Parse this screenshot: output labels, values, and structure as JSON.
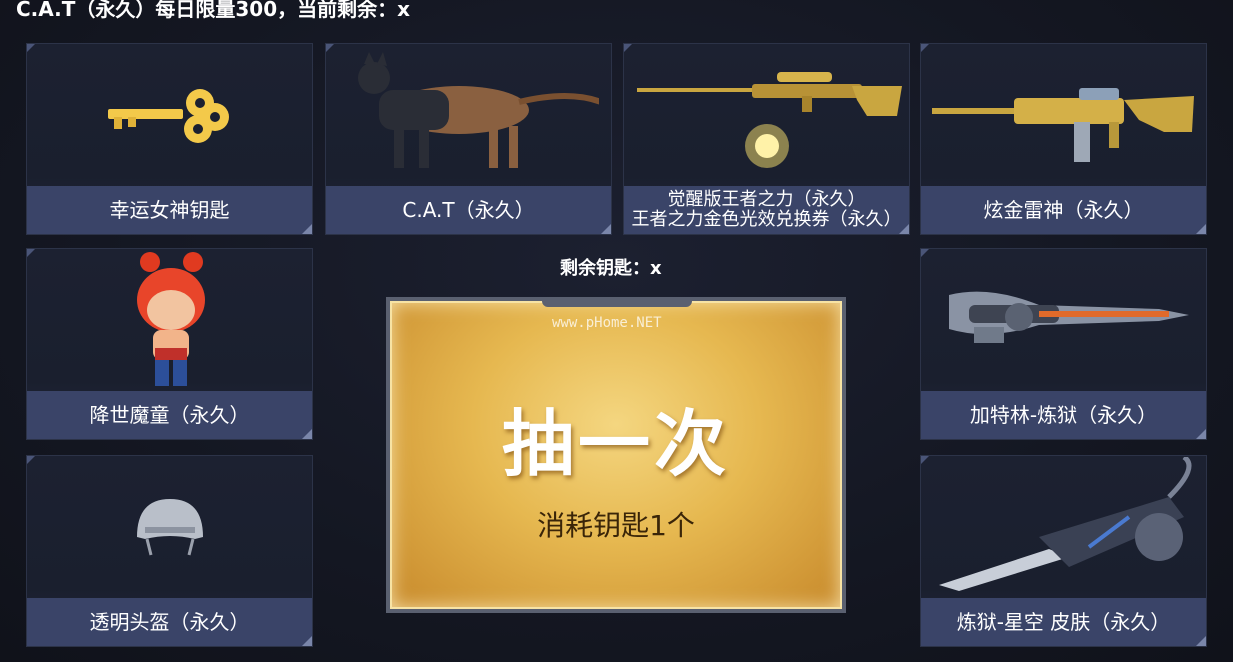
{
  "header": {
    "text": "C.A.T（永久）每日限量300，当前剩余：x"
  },
  "cards": [
    {
      "label": "幸运女神钥匙",
      "icon": "key-icon"
    },
    {
      "label": "C.A.T（永久）",
      "icon": "cat-icon"
    },
    {
      "label_line1": "觉醒版王者之力（永久）",
      "label_line2": "王者之力金色光效兑换券（永久）",
      "icon": "sniper-rifle-icon"
    },
    {
      "label": "炫金雷神（永久）",
      "icon": "assault-rifle-icon"
    },
    {
      "label": "降世魔童（永久）",
      "icon": "character-icon"
    },
    {
      "label": "加特林-炼狱（永久）",
      "icon": "gatling-icon"
    },
    {
      "label": "透明头盔（永久）",
      "icon": "helmet-icon"
    },
    {
      "label": "炼狱-星空 皮肤（永久）",
      "icon": "gatling-skin-icon"
    }
  ],
  "remaining_keys": "剩余钥匙：x",
  "draw_button": {
    "title": "抽一次",
    "subtitle": "消耗钥匙1个",
    "watermark": "www.pHome.NET"
  },
  "colors": {
    "background": "#141722",
    "label_bar": "#3a4468",
    "gold": "#e6b850"
  }
}
